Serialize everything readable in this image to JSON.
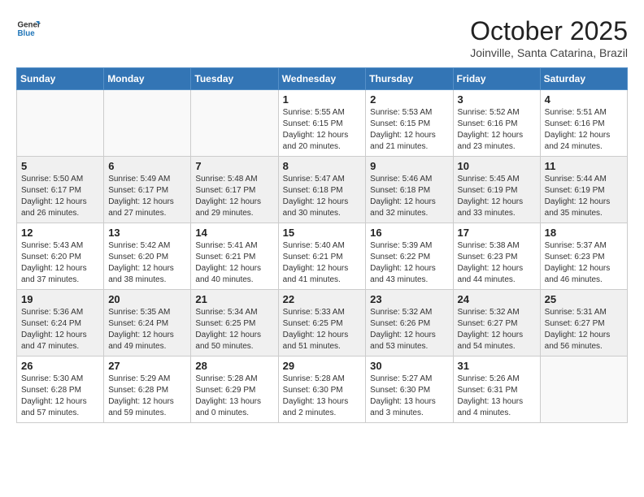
{
  "header": {
    "logo": {
      "general": "General",
      "blue": "Blue"
    },
    "title": "October 2025",
    "location": "Joinville, Santa Catarina, Brazil"
  },
  "weekdays": [
    "Sunday",
    "Monday",
    "Tuesday",
    "Wednesday",
    "Thursday",
    "Friday",
    "Saturday"
  ],
  "weeks": [
    [
      {
        "day": "",
        "info": ""
      },
      {
        "day": "",
        "info": ""
      },
      {
        "day": "",
        "info": ""
      },
      {
        "day": "1",
        "info": "Sunrise: 5:55 AM\nSunset: 6:15 PM\nDaylight: 12 hours\nand 20 minutes."
      },
      {
        "day": "2",
        "info": "Sunrise: 5:53 AM\nSunset: 6:15 PM\nDaylight: 12 hours\nand 21 minutes."
      },
      {
        "day": "3",
        "info": "Sunrise: 5:52 AM\nSunset: 6:16 PM\nDaylight: 12 hours\nand 23 minutes."
      },
      {
        "day": "4",
        "info": "Sunrise: 5:51 AM\nSunset: 6:16 PM\nDaylight: 12 hours\nand 24 minutes."
      }
    ],
    [
      {
        "day": "5",
        "info": "Sunrise: 5:50 AM\nSunset: 6:17 PM\nDaylight: 12 hours\nand 26 minutes."
      },
      {
        "day": "6",
        "info": "Sunrise: 5:49 AM\nSunset: 6:17 PM\nDaylight: 12 hours\nand 27 minutes."
      },
      {
        "day": "7",
        "info": "Sunrise: 5:48 AM\nSunset: 6:17 PM\nDaylight: 12 hours\nand 29 minutes."
      },
      {
        "day": "8",
        "info": "Sunrise: 5:47 AM\nSunset: 6:18 PM\nDaylight: 12 hours\nand 30 minutes."
      },
      {
        "day": "9",
        "info": "Sunrise: 5:46 AM\nSunset: 6:18 PM\nDaylight: 12 hours\nand 32 minutes."
      },
      {
        "day": "10",
        "info": "Sunrise: 5:45 AM\nSunset: 6:19 PM\nDaylight: 12 hours\nand 33 minutes."
      },
      {
        "day": "11",
        "info": "Sunrise: 5:44 AM\nSunset: 6:19 PM\nDaylight: 12 hours\nand 35 minutes."
      }
    ],
    [
      {
        "day": "12",
        "info": "Sunrise: 5:43 AM\nSunset: 6:20 PM\nDaylight: 12 hours\nand 37 minutes."
      },
      {
        "day": "13",
        "info": "Sunrise: 5:42 AM\nSunset: 6:20 PM\nDaylight: 12 hours\nand 38 minutes."
      },
      {
        "day": "14",
        "info": "Sunrise: 5:41 AM\nSunset: 6:21 PM\nDaylight: 12 hours\nand 40 minutes."
      },
      {
        "day": "15",
        "info": "Sunrise: 5:40 AM\nSunset: 6:21 PM\nDaylight: 12 hours\nand 41 minutes."
      },
      {
        "day": "16",
        "info": "Sunrise: 5:39 AM\nSunset: 6:22 PM\nDaylight: 12 hours\nand 43 minutes."
      },
      {
        "day": "17",
        "info": "Sunrise: 5:38 AM\nSunset: 6:23 PM\nDaylight: 12 hours\nand 44 minutes."
      },
      {
        "day": "18",
        "info": "Sunrise: 5:37 AM\nSunset: 6:23 PM\nDaylight: 12 hours\nand 46 minutes."
      }
    ],
    [
      {
        "day": "19",
        "info": "Sunrise: 5:36 AM\nSunset: 6:24 PM\nDaylight: 12 hours\nand 47 minutes."
      },
      {
        "day": "20",
        "info": "Sunrise: 5:35 AM\nSunset: 6:24 PM\nDaylight: 12 hours\nand 49 minutes."
      },
      {
        "day": "21",
        "info": "Sunrise: 5:34 AM\nSunset: 6:25 PM\nDaylight: 12 hours\nand 50 minutes."
      },
      {
        "day": "22",
        "info": "Sunrise: 5:33 AM\nSunset: 6:25 PM\nDaylight: 12 hours\nand 51 minutes."
      },
      {
        "day": "23",
        "info": "Sunrise: 5:32 AM\nSunset: 6:26 PM\nDaylight: 12 hours\nand 53 minutes."
      },
      {
        "day": "24",
        "info": "Sunrise: 5:32 AM\nSunset: 6:27 PM\nDaylight: 12 hours\nand 54 minutes."
      },
      {
        "day": "25",
        "info": "Sunrise: 5:31 AM\nSunset: 6:27 PM\nDaylight: 12 hours\nand 56 minutes."
      }
    ],
    [
      {
        "day": "26",
        "info": "Sunrise: 5:30 AM\nSunset: 6:28 PM\nDaylight: 12 hours\nand 57 minutes."
      },
      {
        "day": "27",
        "info": "Sunrise: 5:29 AM\nSunset: 6:28 PM\nDaylight: 12 hours\nand 59 minutes."
      },
      {
        "day": "28",
        "info": "Sunrise: 5:28 AM\nSunset: 6:29 PM\nDaylight: 13 hours\nand 0 minutes."
      },
      {
        "day": "29",
        "info": "Sunrise: 5:28 AM\nSunset: 6:30 PM\nDaylight: 13 hours\nand 2 minutes."
      },
      {
        "day": "30",
        "info": "Sunrise: 5:27 AM\nSunset: 6:30 PM\nDaylight: 13 hours\nand 3 minutes."
      },
      {
        "day": "31",
        "info": "Sunrise: 5:26 AM\nSunset: 6:31 PM\nDaylight: 13 hours\nand 4 minutes."
      },
      {
        "day": "",
        "info": ""
      }
    ]
  ]
}
